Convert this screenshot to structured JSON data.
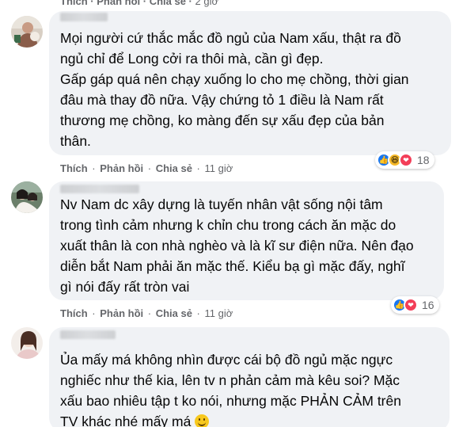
{
  "top_actions": {
    "like": "Thích",
    "reply": "Phản hồi",
    "share": "Chia sẻ",
    "time": "2 giờ"
  },
  "comments": [
    {
      "text": "Mọi người cứ thắc mắc đồ ngủ của Nam xấu, thật ra đồ\nngủ chỉ để Long cởi ra thôi mà, cần gì đẹp.\nGấp gáp quá nên chạy xuống lo cho mẹ chồng, thời gian\nđâu mà thay đồ nữa. Vậy chứng tỏ 1 điều là Nam rất\nthương mẹ chồng, ko màng đến sự xấu đẹp của bản\nthân.",
      "like": "Thích",
      "reply": "Phản hồi",
      "share": "Chia sẻ",
      "time": "11 giờ",
      "reaction_count": "18",
      "reactions": [
        "like-reaction",
        "haha-reaction",
        "love-reaction"
      ]
    },
    {
      "author": "Hiếu Nguyễn",
      "text": "Nv Nam dc xây dựng là tuyến nhân vật sống nội tâm\ntrong tình cảm nhưng k chỉn chu trong cách ăn mặc do\nxuất thân là con nhà nghèo và là kĩ sư điện nữa. Nên đạo\ndiễn bắt Nam phải ăn mặc thế. Kiểu bạ gì mặc đấy, nghĩ\ngì nói đấy rất tròn vai",
      "like": "Thích",
      "reply": "Phản hồi",
      "share": "Chia sẻ",
      "time": "11 giờ",
      "reaction_count": "16",
      "reactions": [
        "like-reaction",
        "love-reaction"
      ]
    },
    {
      "text": "Ủa mấy má không nhìn được cái bộ đồ ngủ mặc ngực\nnghiếc như thế kia, lên tv n phản cảm mà kêu soi? Mặc\nxấu bao nhiêu tập t ko nói, nhưng mặc PHẢN CẢM trên\nTV khác nhé mấy má",
      "trailing_emoji": "smile-emoji"
    }
  ],
  "colors": {
    "bubble": "#f0f2f5",
    "secondary_text": "#65676b",
    "like_blue": "#1877f2",
    "love_red": "#f33e58",
    "haha_yellow": "#f7b928"
  }
}
